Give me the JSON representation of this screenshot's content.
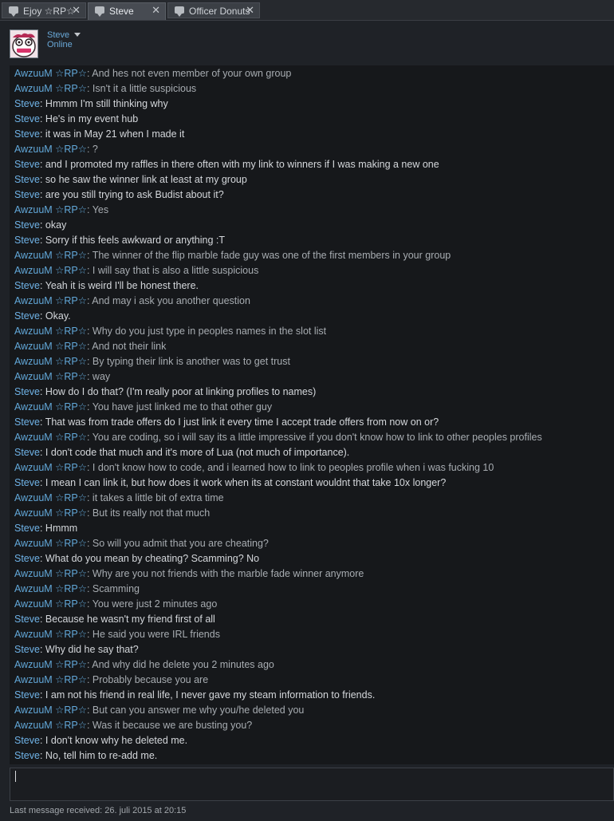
{
  "tabs": [
    {
      "label": "Ejoy ☆RP☆"
    },
    {
      "label": "Steve"
    },
    {
      "label": "Officer Donuts"
    }
  ],
  "header": {
    "name": "Steve",
    "status": "Online"
  },
  "messages": [
    {
      "who": "AwzuuM ☆RP☆",
      "text": "And hes not even member of your own group"
    },
    {
      "who": "AwzuuM ☆RP☆",
      "text": "Isn't it a little suspicious"
    },
    {
      "who": "Steve",
      "text": "Hmmm I'm still thinking why"
    },
    {
      "who": "Steve",
      "text": "He's in my event hub"
    },
    {
      "who": "Steve",
      "text": "it was in May 21 when I made it"
    },
    {
      "who": "AwzuuM ☆RP☆",
      "text": "?"
    },
    {
      "who": "Steve",
      "text": "and I promoted my raffles in there often with my link to winners if I was making a new one"
    },
    {
      "who": "Steve",
      "text": "so he saw the winner link at least at my group"
    },
    {
      "who": "Steve",
      "text": "are you still trying to ask Budist about it?"
    },
    {
      "who": "AwzuuM ☆RP☆",
      "text": "Yes"
    },
    {
      "who": "Steve",
      "text": "okay"
    },
    {
      "who": "Steve",
      "text": "Sorry if this feels awkward or anything :T"
    },
    {
      "who": "AwzuuM ☆RP☆",
      "text": "The winner of the flip marble fade guy was one of the first members in your group"
    },
    {
      "who": "AwzuuM ☆RP☆",
      "text": "I will say that is also a little suspicious"
    },
    {
      "who": "Steve",
      "text": "Yeah it is weird I'll be honest there."
    },
    {
      "who": "AwzuuM ☆RP☆",
      "text": "And may i ask you another question"
    },
    {
      "who": "Steve",
      "text": "Okay."
    },
    {
      "who": "AwzuuM ☆RP☆",
      "text": "Why do you just type in peoples names in the slot list"
    },
    {
      "who": "AwzuuM ☆RP☆",
      "text": "And not their link"
    },
    {
      "who": "AwzuuM ☆RP☆",
      "text": "By typing their link is another was to get trust"
    },
    {
      "who": "AwzuuM ☆RP☆",
      "text": "way"
    },
    {
      "who": "Steve",
      "text": "How do I do that?  (I'm really poor at linking profiles to names)"
    },
    {
      "who": "AwzuuM ☆RP☆",
      "text": "You have just linked me to that other guy"
    },
    {
      "who": "Steve",
      "text": "That was from trade offers do I just link it every time I accept trade offers from now on or?"
    },
    {
      "who": "AwzuuM ☆RP☆",
      "text": "You are coding, so i will say its a little impressive if you don't know how to link to other peoples profiles"
    },
    {
      "who": "Steve",
      "text": "I don't code that much and it's more of Lua (not much of importance)."
    },
    {
      "who": "AwzuuM ☆RP☆",
      "text": "I don't know how to code, and i learned how to link to peoples profile when i was fucking 10"
    },
    {
      "who": "Steve",
      "text": "I mean I can link it, but how does it work when its at constant wouldnt that take 10x longer?"
    },
    {
      "who": "AwzuuM ☆RP☆",
      "text": "it takes a little bit of extra time"
    },
    {
      "who": "AwzuuM ☆RP☆",
      "text": "But its really not that much"
    },
    {
      "who": "Steve",
      "text": "Hmmm"
    },
    {
      "who": "AwzuuM ☆RP☆",
      "text": "So will you admit that you are cheating?"
    },
    {
      "who": "Steve",
      "text": "What do you mean by cheating? Scamming? No"
    },
    {
      "who": "AwzuuM ☆RP☆",
      "text": "Why are you not friends with the marble fade winner anymore"
    },
    {
      "who": "AwzuuM ☆RP☆",
      "text": "Scamming"
    },
    {
      "who": "AwzuuM ☆RP☆",
      "text": "You were just 2 minutes ago"
    },
    {
      "who": "Steve",
      "text": "Because he wasn't my friend first of all"
    },
    {
      "who": "AwzuuM ☆RP☆",
      "text": "He said you were IRL friends"
    },
    {
      "who": "Steve",
      "text": "Why did he say that?"
    },
    {
      "who": "AwzuuM ☆RP☆",
      "text": "And why did he delete you 2 minutes ago"
    },
    {
      "who": "AwzuuM ☆RP☆",
      "text": "Probably because you are"
    },
    {
      "who": "Steve",
      "text": "I am not his friend in real life, I never gave my steam information to friends."
    },
    {
      "who": "AwzuuM ☆RP☆",
      "text": "But can you answer me why you/he deleted you"
    },
    {
      "who": "AwzuuM ☆RP☆",
      "text": "Was it because we are busting you?"
    },
    {
      "who": "Steve",
      "text": "I don't know why he deleted me."
    },
    {
      "who": "Steve",
      "text": "No, tell him to re-add me."
    }
  ],
  "footer": {
    "text": "Last message received: 26. juli 2015 at 20:15"
  }
}
